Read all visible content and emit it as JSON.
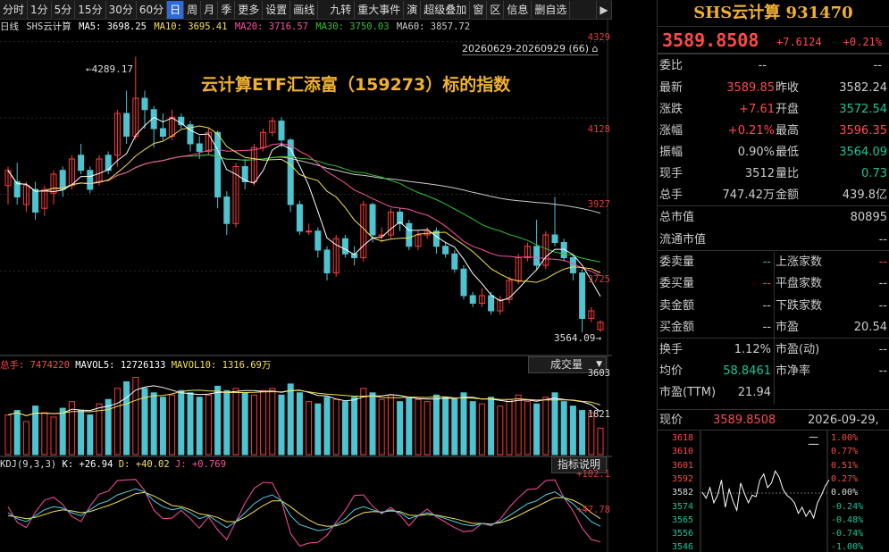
{
  "toolbar": {
    "items": [
      "分时",
      "1分",
      "5分",
      "15分",
      "30分",
      "60分",
      "日",
      "周",
      "月",
      "季",
      "更多",
      "设置",
      "画线",
      "九转",
      "重大事件",
      "演",
      "超级叠加",
      "窗",
      "区",
      "信息",
      "删自选"
    ],
    "active_index": 6
  },
  "ma_line": {
    "period": "日线",
    "name": "SHS云计算",
    "ma5": "MA5: 3698.25",
    "ma10": "MA10: 3695.41",
    "ma20": "MA20: 3716.57",
    "ma30": "MA30: 3750.03",
    "ma60": "MA60: 3857.72"
  },
  "range_label": "20260629-20260929 (66)",
  "overlay_title": "云计算ETF汇添富（159273）标的指数",
  "high_tag": "4289.17",
  "low_tag": "3564.09",
  "price_axis": [
    "4329",
    "4128",
    "3927",
    "3725"
  ],
  "volume_header": {
    "label": "总手:",
    "total": "7474220",
    "mavol5": "MAVOL5: 12726133",
    "mavol10": "MAVOL10: 1316.69万"
  },
  "volume_axis": [
    "3603",
    "1821"
  ],
  "volume_button": "成交量",
  "kdj_header": {
    "label": "KDJ(9,3,3)",
    "k": "K: +26.94",
    "d": "D: +40.02",
    "j": "J: +0.769"
  },
  "kdj_axis": [
    "+102.1",
    "+47.78"
  ],
  "kdj_button": "指标说明",
  "colors": {
    "up": "#ff3b3b",
    "down": "#4fc3cf",
    "ma5": "#ffffff",
    "ma10": "#f5e050",
    "ma20": "#ff4fa0",
    "ma30": "#30c030",
    "ma60": "#cccccc"
  },
  "panel": {
    "title": "SHS云计算 931470",
    "price": "3589.8508",
    "change": "+7.6124",
    "pct": "+0.21%",
    "weibi_label": "委比",
    "weibi_value": "--",
    "weibi_value2": "--",
    "latest_label": "最新",
    "latest": "3589.85",
    "prev_label": "昨收",
    "prev": "3582.24",
    "zd_label": "涨跌",
    "zd": "+7.61",
    "open_label": "开盘",
    "open": "3572.54",
    "zf_label": "涨幅",
    "zf": "+0.21%",
    "high_label": "最高",
    "high": "3596.35",
    "amp_label": "振幅",
    "amp": "0.90%",
    "low_label": "最低",
    "low": "3564.09",
    "xs_label": "现手",
    "xs": "3512",
    "lb_label": "量比",
    "lb": "0.73",
    "zs_label": "总手",
    "zs": "747.42万",
    "je_label": "金额",
    "je": "439.8亿",
    "zsz_label": "总市值",
    "zsz": "80895",
    "ltsz_label": "流通市值",
    "ltsz": "--",
    "wmp_label": "委卖量",
    "wmp": "--",
    "szjs_label": "上涨家数",
    "szjs": "--",
    "wmr_label": "委买量",
    "wmr": "--",
    "ppjs_label": "平盘家数",
    "ppjs": "--",
    "mje_label": "卖金额",
    "mje": "--",
    "xdjs_label": "下跌家数",
    "xdjs": "--",
    "mrje_label": "买金额",
    "mrje": "--",
    "sy_label": "市盈",
    "sy": "20.54",
    "hs_label": "换手",
    "hs": "1.12%",
    "sydt_label": "市盈(动)",
    "sydt": "--",
    "jj_label": "均价",
    "jj": "58.8461",
    "sjl_label": "市净率",
    "sjl": "--",
    "ttm_label": "市盈(TTM)",
    "ttm": "21.94"
  },
  "mini": {
    "price_label": "现价",
    "price": "3589.8508",
    "date": "2026-09-29,二",
    "left_axis": [
      "3618",
      "3610",
      "3601",
      "3592",
      "3582",
      "3574",
      "3565",
      "3556",
      "3546"
    ],
    "right_axis": [
      "1.00%",
      "0.77%",
      "0.51%",
      "0.27%",
      "0.00%",
      "-0.24%",
      "-0.48%",
      "-0.74%",
      "-1.00%"
    ]
  },
  "candles": [
    [
      3950,
      3990,
      3900,
      4000
    ],
    [
      3960,
      3920,
      3900,
      4010
    ],
    [
      3900,
      3950,
      3880,
      3960
    ],
    [
      3940,
      3880,
      3860,
      3960
    ],
    [
      3890,
      3940,
      3870,
      3950
    ],
    [
      3930,
      3980,
      3900,
      3990
    ],
    [
      3990,
      3940,
      3920,
      4000
    ],
    [
      3950,
      4020,
      3940,
      4030
    ],
    [
      4030,
      3990,
      3980,
      4060
    ],
    [
      3990,
      3940,
      3930,
      4000
    ],
    [
      3960,
      4020,
      3950,
      4030
    ],
    [
      4030,
      3990,
      3980,
      4040
    ],
    [
      4030,
      4140,
      4000,
      4150
    ],
    [
      4140,
      4080,
      4060,
      4200
    ],
    [
      4080,
      4180,
      4070,
      4289
    ],
    [
      4180,
      4150,
      4100,
      4200
    ],
    [
      4150,
      4100,
      4050,
      4160
    ],
    [
      4100,
      4080,
      4070,
      4140
    ],
    [
      4080,
      4130,
      4070,
      4150
    ],
    [
      4130,
      4110,
      4100,
      4140
    ],
    [
      4110,
      4060,
      4040,
      4120
    ],
    [
      4060,
      4040,
      4020,
      4080
    ],
    [
      4040,
      4090,
      4030,
      4100
    ],
    [
      4090,
      3920,
      3890,
      4095
    ],
    [
      3920,
      3850,
      3820,
      3935
    ],
    [
      3850,
      4000,
      3840,
      4010
    ],
    [
      4000,
      3960,
      3940,
      4020
    ],
    [
      3960,
      4050,
      3950,
      4060
    ],
    [
      4050,
      4090,
      4040,
      4100
    ],
    [
      4090,
      4120,
      4080,
      4130
    ],
    [
      4120,
      4070,
      4050,
      4130
    ],
    [
      4070,
      3900,
      3880,
      4075
    ],
    [
      3900,
      3830,
      3820,
      3910
    ],
    [
      3830,
      3830,
      3820,
      3850
    ],
    [
      3830,
      3780,
      3760,
      3840
    ],
    [
      3780,
      3720,
      3700,
      3790
    ],
    [
      3720,
      3810,
      3710,
      3820
    ],
    [
      3810,
      3770,
      3760,
      3820
    ],
    [
      3770,
      3760,
      3740,
      3790
    ],
    [
      3760,
      3900,
      3750,
      3910
    ],
    [
      3900,
      3820,
      3800,
      3905
    ],
    [
      3820,
      3820,
      3800,
      3840
    ],
    [
      3820,
      3880,
      3810,
      3890
    ],
    [
      3880,
      3850,
      3830,
      3890
    ],
    [
      3850,
      3790,
      3780,
      3860
    ],
    [
      3790,
      3820,
      3780,
      3830
    ],
    [
      3820,
      3830,
      3810,
      3840
    ],
    [
      3830,
      3790,
      3770,
      3840
    ],
    [
      3790,
      3770,
      3760,
      3800
    ],
    [
      3770,
      3730,
      3720,
      3780
    ],
    [
      3730,
      3660,
      3650,
      3740
    ],
    [
      3660,
      3640,
      3630,
      3670
    ],
    [
      3640,
      3660,
      3630,
      3680
    ],
    [
      3660,
      3620,
      3610,
      3670
    ],
    [
      3620,
      3650,
      3610,
      3660
    ],
    [
      3650,
      3700,
      3640,
      3710
    ],
    [
      3700,
      3760,
      3690,
      3770
    ],
    [
      3760,
      3790,
      3750,
      3800
    ],
    [
      3790,
      3740,
      3730,
      3860
    ],
    [
      3740,
      3820,
      3730,
      3830
    ],
    [
      3820,
      3800,
      3790,
      3920
    ],
    [
      3800,
      3760,
      3750,
      3810
    ],
    [
      3760,
      3720,
      3700,
      3770
    ],
    [
      3720,
      3600,
      3564,
      3730
    ],
    [
      3600,
      3620,
      3590,
      3630
    ],
    [
      3570,
      3590,
      3564,
      3596
    ]
  ],
  "volumes": [
    18,
    20,
    15,
    22,
    19,
    17,
    21,
    24,
    20,
    18,
    23,
    25,
    30,
    33,
    35,
    30,
    28,
    26,
    27,
    29,
    28,
    26,
    27,
    31,
    29,
    30,
    28,
    27,
    29,
    30,
    27,
    32,
    28,
    24,
    23,
    26,
    25,
    24,
    26,
    30,
    28,
    25,
    27,
    24,
    26,
    25,
    24,
    27,
    26,
    25,
    28,
    24,
    23,
    26,
    22,
    25,
    27,
    24,
    23,
    26,
    28,
    24,
    22,
    20,
    19,
    12
  ],
  "kdj_k": [
    50,
    40,
    35,
    45,
    55,
    60,
    58,
    50,
    45,
    55,
    65,
    70,
    80,
    85,
    90,
    85,
    70,
    60,
    55,
    58,
    50,
    40,
    45,
    35,
    25,
    35,
    50,
    65,
    75,
    80,
    70,
    45,
    30,
    25,
    20,
    22,
    30,
    40,
    55,
    60,
    55,
    50,
    55,
    50,
    40,
    45,
    50,
    45,
    40,
    35,
    30,
    28,
    32,
    30,
    35,
    45,
    55,
    65,
    70,
    80,
    85,
    75,
    65,
    50,
    35,
    27
  ],
  "kdj_d": [
    45,
    43,
    40,
    42,
    47,
    52,
    55,
    53,
    50,
    52,
    57,
    62,
    68,
    75,
    82,
    84,
    78,
    70,
    62,
    60,
    55,
    48,
    46,
    42,
    35,
    35,
    42,
    52,
    62,
    70,
    70,
    60,
    48,
    38,
    30,
    27,
    28,
    33,
    43,
    50,
    52,
    51,
    53,
    52,
    46,
    45,
    47,
    46,
    43,
    40,
    36,
    32,
    32,
    31,
    33,
    38,
    45,
    53,
    60,
    68,
    75,
    75,
    71,
    63,
    50,
    40
  ],
  "kdj_j": [
    60,
    34,
    25,
    51,
    71,
    76,
    64,
    44,
    35,
    61,
    81,
    86,
    104,
    105,
    106,
    87,
    54,
    40,
    41,
    54,
    40,
    24,
    43,
    21,
    5,
    35,
    66,
    91,
    101,
    100,
    70,
    15,
    -6,
    -1,
    0,
    12,
    34,
    54,
    79,
    80,
    61,
    48,
    59,
    46,
    28,
    45,
    56,
    43,
    34,
    25,
    18,
    20,
    32,
    28,
    39,
    59,
    75,
    89,
    90,
    104,
    105,
    75,
    53,
    24,
    5,
    1
  ],
  "mini_line": [
    3582,
    3578,
    3585,
    3575,
    3580,
    3590,
    3572,
    3584,
    3576,
    3570,
    3588,
    3581,
    3575,
    3580,
    3579,
    3590,
    3594,
    3585,
    3588,
    3596,
    3592,
    3584,
    3580,
    3578,
    3575,
    3568,
    3572,
    3566,
    3570,
    3565,
    3575,
    3580,
    3586,
    3590
  ]
}
